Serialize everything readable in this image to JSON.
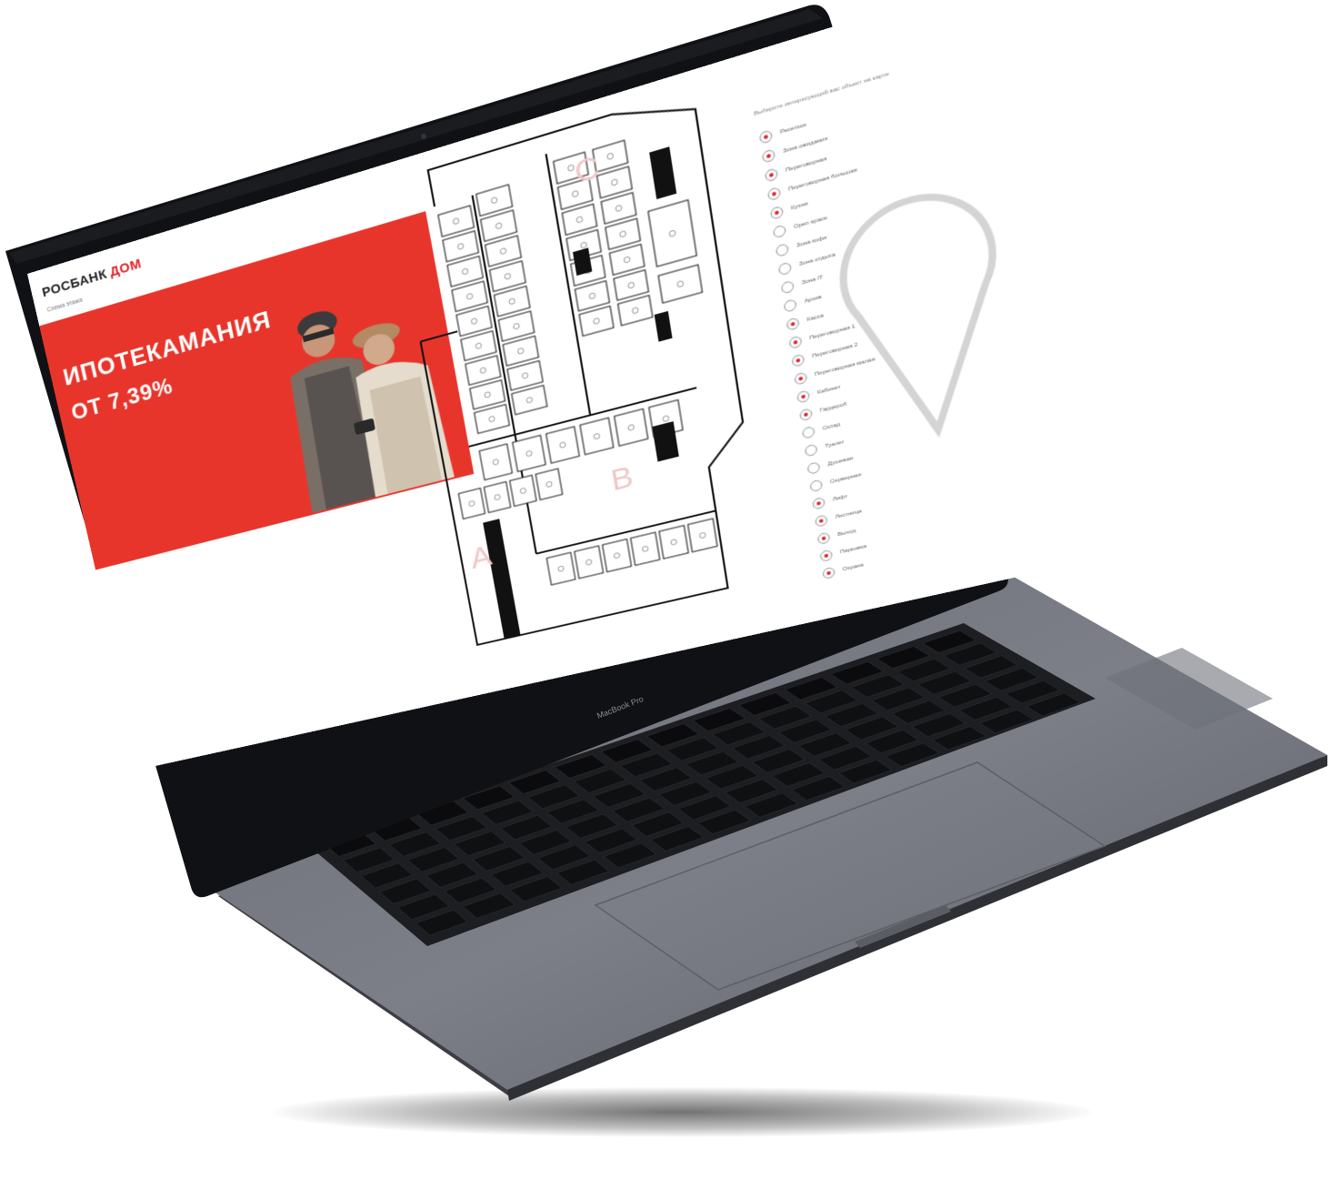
{
  "device": {
    "model_label": "MacBook Pro"
  },
  "site": {
    "brand_main": "РОСБАНК",
    "brand_accent": "ДОМ",
    "brand_subtitle": "Схема этажа",
    "accent_color": "#e31e24"
  },
  "promo": {
    "line1": "ИПОТЕКАМАНИЯ",
    "line2": "ОТ 7,39%",
    "background": "#e8352b"
  },
  "floorplan": {
    "zone_a": "A",
    "zone_b": "B",
    "zone_c": "C"
  },
  "legend": {
    "title": "Выберите интересующий вас объект на карте",
    "items": [
      {
        "label": "Ресепшн",
        "marker": "red"
      },
      {
        "label": "Зона ожидания",
        "marker": "red"
      },
      {
        "label": "Переговорная",
        "marker": "red"
      },
      {
        "label": "Переговорная большая",
        "marker": "red"
      },
      {
        "label": "Кухня",
        "marker": "red"
      },
      {
        "label": "Open space",
        "marker": "plain"
      },
      {
        "label": "Зона кофе",
        "marker": "plain"
      },
      {
        "label": "Зона отдыха",
        "marker": "plain"
      },
      {
        "label": "Зона IT",
        "marker": "plain"
      },
      {
        "label": "Архив",
        "marker": "plain"
      },
      {
        "label": "Касса",
        "marker": "red"
      },
      {
        "label": "Переговорная 1",
        "marker": "red"
      },
      {
        "label": "Переговорная 2",
        "marker": "red"
      },
      {
        "label": "Переговорная малая",
        "marker": "red"
      },
      {
        "label": "Кабинет",
        "marker": "red"
      },
      {
        "label": "Гардероб",
        "marker": "red"
      },
      {
        "label": "Склад",
        "marker": "plain"
      },
      {
        "label": "Туалет",
        "marker": "plain"
      },
      {
        "label": "Душевая",
        "marker": "plain"
      },
      {
        "label": "Серверная",
        "marker": "plain"
      },
      {
        "label": "Лифт",
        "marker": "red"
      },
      {
        "label": "Лестница",
        "marker": "red"
      },
      {
        "label": "Выход",
        "marker": "red"
      },
      {
        "label": "Парковка",
        "marker": "red"
      },
      {
        "label": "Охрана",
        "marker": "red"
      }
    ]
  }
}
